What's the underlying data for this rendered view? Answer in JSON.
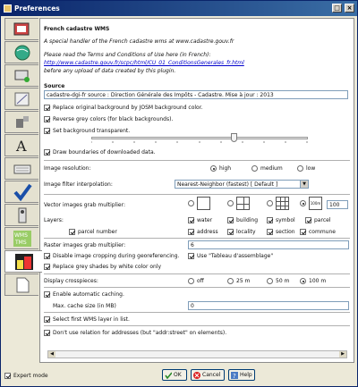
{
  "window": {
    "title": "Preferences"
  },
  "header": {
    "title": "French cadastre WMS",
    "subtitle": "A special handler of the French cadastre wms at www.cadastre.gouv.fr",
    "terms_line1": "Please read the Terms and Conditions of Use here (in French):",
    "terms_link": "http://www.cadastre.gouv.fr/scpc/html/CU_01_ConditionsGenerales_fr.html",
    "terms_line2": "before any upload of data created by this plugin."
  },
  "source": {
    "label": "Source",
    "value": "cadastre-dgi-fr source : Direction Générale des Impôts - Cadastre. Mise à jour : 2013"
  },
  "options": {
    "replace_bg": "Replace original background by JOSM background color.",
    "reverse_grey": "Reverse grey colors (for black backgrounds).",
    "transparent": "Set background transparent.",
    "draw_boundaries": "Draw boundaries of downloaded data."
  },
  "transparency": {
    "level": 0.66
  },
  "resolution": {
    "label": "Image resolution:",
    "options": [
      "high",
      "medium",
      "low"
    ],
    "selected": "high"
  },
  "interpolation": {
    "label": "Image filter interpolation:",
    "value": "Nearest-Neighbor (fastest) [ Default ]"
  },
  "vector": {
    "label": "Vector images grab multiplier:",
    "custom_label": "100m",
    "custom_value": "100"
  },
  "layers": {
    "label": "Layers:",
    "row1": [
      "water",
      "building",
      "symbol",
      "parcel"
    ],
    "row2": [
      "parcel number",
      "address",
      "locality",
      "section",
      "commune"
    ]
  },
  "raster": {
    "label": "Raster images grab multiplier:",
    "value": "6",
    "disable_crop": "Disable image cropping during georeferencing.",
    "use_tableau": "Use \"Tableau d'assemblage\"",
    "replace_grey": "Replace grey shades by white color only"
  },
  "crosspieces": {
    "label": "Display crosspieces:",
    "options": [
      "off",
      "25 m",
      "50 m",
      "100 m"
    ],
    "selected": "100 m"
  },
  "caching": {
    "enable": "Enable automatic caching.",
    "max_label": "Max. cache size (in MB)",
    "max_value": "0"
  },
  "misc": {
    "first_wms": "Select first WMS layer in list.",
    "dont_use_relation": "Don't use relation for addresses (but \"addr:street\" on elements)."
  },
  "footer": {
    "expert_mode": "Expert mode",
    "ok": "OK",
    "cancel": "Cancel",
    "help": "Help"
  }
}
